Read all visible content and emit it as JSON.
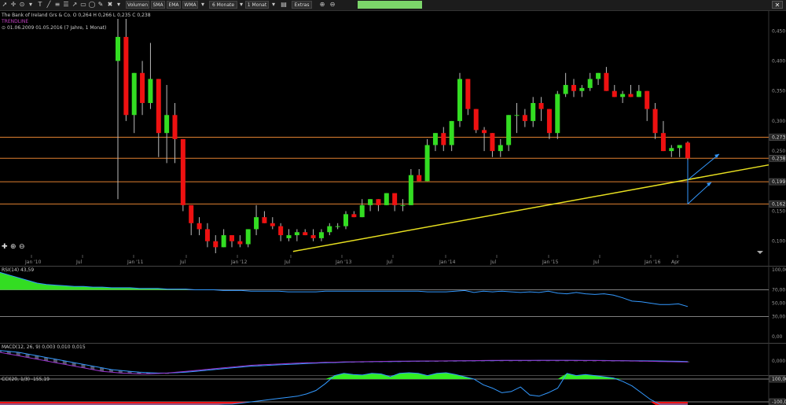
{
  "toolbar": {
    "buttons": [
      "Volumen",
      "SMA",
      "EMA",
      "WMA",
      "6 Monate",
      "1 Monat",
      "Extras"
    ],
    "close_label": "✕"
  },
  "info": {
    "symbol": "The Bank of Ireland Grs & Co.",
    "ohlc": "O 0,264  H 0,266  L 0,235  C 0,238",
    "overlay": "TRENDLINE",
    "range": "01.06.2009  01.05.2016 (7 Jahre, 1 Monat)"
  },
  "colors": {
    "up": "#33dd22",
    "down": "#ee1111",
    "hline": "#e08030",
    "trend": "#e8e020",
    "arrow": "#3399ff",
    "indicator_line": "#3399ff",
    "rsi_fill": "#33dd22",
    "macd_line": "#9933cc",
    "cci_up": "#33ee22",
    "cci_down": "#ee1111"
  },
  "chart_data": [
    {
      "type": "candlestick",
      "title": "The Bank of Ireland Grs & Co.",
      "x_ticks": [
        "Jan '10",
        "Jul",
        "Jan '11",
        "Jul",
        "Jan '12",
        "Jul",
        "Jan '13",
        "Jul",
        "Jan '14",
        "Jul",
        "Jan '15",
        "Jul",
        "Jan '16",
        "Apr"
      ],
      "y_ticks": [
        "0,450",
        "0,400",
        "0,350",
        "0,300",
        "0,250",
        "0,200",
        "0,150",
        "0,100"
      ],
      "ylim": [
        0.08,
        0.47
      ],
      "horizontal_levels": [
        "0,273",
        "0,238",
        "0,199",
        "0,162"
      ],
      "candles": [
        {
          "o": 0.4,
          "h": 0.47,
          "l": 0.17,
          "c": 0.44
        },
        {
          "o": 0.44,
          "h": 0.47,
          "l": 0.3,
          "c": 0.31
        },
        {
          "o": 0.31,
          "h": 0.38,
          "l": 0.28,
          "c": 0.38
        },
        {
          "o": 0.38,
          "h": 0.4,
          "l": 0.31,
          "c": 0.33
        },
        {
          "o": 0.33,
          "h": 0.43,
          "l": 0.32,
          "c": 0.37
        },
        {
          "o": 0.37,
          "h": 0.37,
          "l": 0.24,
          "c": 0.28
        },
        {
          "o": 0.28,
          "h": 0.36,
          "l": 0.23,
          "c": 0.31
        },
        {
          "o": 0.31,
          "h": 0.33,
          "l": 0.23,
          "c": 0.27
        },
        {
          "o": 0.27,
          "h": 0.27,
          "l": 0.15,
          "c": 0.16
        },
        {
          "o": 0.16,
          "h": 0.16,
          "l": 0.11,
          "c": 0.13
        },
        {
          "o": 0.13,
          "h": 0.14,
          "l": 0.11,
          "c": 0.12
        },
        {
          "o": 0.12,
          "h": 0.13,
          "l": 0.09,
          "c": 0.1
        },
        {
          "o": 0.1,
          "h": 0.11,
          "l": 0.08,
          "c": 0.09
        },
        {
          "o": 0.09,
          "h": 0.12,
          "l": 0.09,
          "c": 0.11
        },
        {
          "o": 0.11,
          "h": 0.11,
          "l": 0.09,
          "c": 0.1
        },
        {
          "o": 0.1,
          "h": 0.11,
          "l": 0.09,
          "c": 0.095
        },
        {
          "o": 0.095,
          "h": 0.12,
          "l": 0.09,
          "c": 0.12
        },
        {
          "o": 0.12,
          "h": 0.16,
          "l": 0.11,
          "c": 0.14
        },
        {
          "o": 0.14,
          "h": 0.15,
          "l": 0.13,
          "c": 0.13
        },
        {
          "o": 0.13,
          "h": 0.14,
          "l": 0.12,
          "c": 0.125
        },
        {
          "o": 0.125,
          "h": 0.13,
          "l": 0.1,
          "c": 0.11
        },
        {
          "o": 0.105,
          "h": 0.12,
          "l": 0.1,
          "c": 0.11
        },
        {
          "o": 0.11,
          "h": 0.12,
          "l": 0.1,
          "c": 0.115
        },
        {
          "o": 0.115,
          "h": 0.12,
          "l": 0.11,
          "c": 0.11
        },
        {
          "o": 0.11,
          "h": 0.12,
          "l": 0.1,
          "c": 0.105
        },
        {
          "o": 0.105,
          "h": 0.12,
          "l": 0.1,
          "c": 0.115
        },
        {
          "o": 0.115,
          "h": 0.13,
          "l": 0.11,
          "c": 0.125
        },
        {
          "o": 0.125,
          "h": 0.13,
          "l": 0.12,
          "c": 0.125
        },
        {
          "o": 0.125,
          "h": 0.15,
          "l": 0.12,
          "c": 0.145
        },
        {
          "o": 0.145,
          "h": 0.15,
          "l": 0.14,
          "c": 0.14
        },
        {
          "o": 0.14,
          "h": 0.17,
          "l": 0.14,
          "c": 0.16
        },
        {
          "o": 0.16,
          "h": 0.17,
          "l": 0.15,
          "c": 0.17
        },
        {
          "o": 0.17,
          "h": 0.17,
          "l": 0.15,
          "c": 0.16
        },
        {
          "o": 0.16,
          "h": 0.18,
          "l": 0.16,
          "c": 0.18
        },
        {
          "o": 0.18,
          "h": 0.17,
          "l": 0.15,
          "c": 0.16
        },
        {
          "o": 0.16,
          "h": 0.17,
          "l": 0.15,
          "c": 0.16
        },
        {
          "o": 0.16,
          "h": 0.22,
          "l": 0.16,
          "c": 0.21
        },
        {
          "o": 0.21,
          "h": 0.22,
          "l": 0.2,
          "c": 0.2
        },
        {
          "o": 0.2,
          "h": 0.27,
          "l": 0.2,
          "c": 0.26
        },
        {
          "o": 0.26,
          "h": 0.28,
          "l": 0.25,
          "c": 0.28
        },
        {
          "o": 0.28,
          "h": 0.29,
          "l": 0.25,
          "c": 0.26
        },
        {
          "o": 0.26,
          "h": 0.3,
          "l": 0.25,
          "c": 0.3
        },
        {
          "o": 0.3,
          "h": 0.38,
          "l": 0.29,
          "c": 0.37
        },
        {
          "o": 0.37,
          "h": 0.37,
          "l": 0.31,
          "c": 0.32
        },
        {
          "o": 0.32,
          "h": 0.32,
          "l": 0.28,
          "c": 0.285
        },
        {
          "o": 0.285,
          "h": 0.29,
          "l": 0.25,
          "c": 0.28
        },
        {
          "o": 0.28,
          "h": 0.28,
          "l": 0.24,
          "c": 0.25
        },
        {
          "o": 0.25,
          "h": 0.27,
          "l": 0.24,
          "c": 0.26
        },
        {
          "o": 0.26,
          "h": 0.31,
          "l": 0.25,
          "c": 0.31
        },
        {
          "o": 0.31,
          "h": 0.33,
          "l": 0.28,
          "c": 0.31
        },
        {
          "o": 0.31,
          "h": 0.32,
          "l": 0.29,
          "c": 0.3
        },
        {
          "o": 0.3,
          "h": 0.34,
          "l": 0.29,
          "c": 0.33
        },
        {
          "o": 0.33,
          "h": 0.34,
          "l": 0.3,
          "c": 0.32
        },
        {
          "o": 0.32,
          "h": 0.32,
          "l": 0.27,
          "c": 0.28
        },
        {
          "o": 0.28,
          "h": 0.35,
          "l": 0.27,
          "c": 0.345
        },
        {
          "o": 0.345,
          "h": 0.38,
          "l": 0.34,
          "c": 0.36
        },
        {
          "o": 0.36,
          "h": 0.37,
          "l": 0.34,
          "c": 0.35
        },
        {
          "o": 0.35,
          "h": 0.36,
          "l": 0.34,
          "c": 0.355
        },
        {
          "o": 0.355,
          "h": 0.38,
          "l": 0.35,
          "c": 0.37
        },
        {
          "o": 0.37,
          "h": 0.38,
          "l": 0.36,
          "c": 0.38
        },
        {
          "o": 0.38,
          "h": 0.39,
          "l": 0.35,
          "c": 0.35
        },
        {
          "o": 0.35,
          "h": 0.36,
          "l": 0.34,
          "c": 0.34
        },
        {
          "o": 0.34,
          "h": 0.35,
          "l": 0.33,
          "c": 0.345
        },
        {
          "o": 0.345,
          "h": 0.36,
          "l": 0.34,
          "c": 0.34
        },
        {
          "o": 0.34,
          "h": 0.36,
          "l": 0.34,
          "c": 0.35
        },
        {
          "o": 0.35,
          "h": 0.35,
          "l": 0.3,
          "c": 0.32
        },
        {
          "o": 0.32,
          "h": 0.33,
          "l": 0.27,
          "c": 0.28
        },
        {
          "o": 0.28,
          "h": 0.3,
          "l": 0.25,
          "c": 0.25
        },
        {
          "o": 0.25,
          "h": 0.26,
          "l": 0.24,
          "c": 0.255
        },
        {
          "o": 0.255,
          "h": 0.26,
          "l": 0.24,
          "c": 0.26
        },
        {
          "o": 0.264,
          "h": 0.266,
          "l": 0.235,
          "c": 0.238
        }
      ]
    },
    {
      "type": "line",
      "title": "RSI(14)  43,59",
      "y_ticks": [
        "100,00",
        "70,00",
        "50,00",
        "30,00",
        "0,00"
      ],
      "ylim": [
        0,
        100
      ],
      "levels": [
        70,
        30
      ],
      "values": [
        96,
        92,
        88,
        84,
        80,
        78,
        77,
        76,
        75,
        75,
        74,
        74,
        73,
        73,
        73,
        72,
        72,
        72,
        71,
        71,
        71,
        70,
        70,
        70,
        69,
        69,
        69,
        68,
        68,
        68,
        68,
        67,
        67,
        67,
        67,
        68,
        68,
        68,
        68,
        68,
        68,
        68,
        68,
        68,
        68,
        68,
        67,
        67,
        67,
        68,
        69,
        66,
        68,
        67,
        68,
        67,
        66,
        67,
        66,
        68,
        65,
        64,
        66,
        64,
        63,
        64,
        62,
        58,
        53,
        52,
        50,
        48,
        48,
        49,
        45
      ]
    },
    {
      "type": "line",
      "title": "MACD(12, 26, 9)  0,003  0,010  0,015",
      "y_ticks": [
        "0,000"
      ],
      "series": [
        {
          "values": [
            0.1,
            0.08,
            0.06,
            0.04,
            0.02,
            0.0,
            -0.02,
            -0.04,
            -0.06,
            -0.08,
            -0.1,
            -0.12,
            -0.13,
            -0.14,
            -0.145,
            -0.15,
            -0.15,
            -0.145,
            -0.14,
            -0.13,
            -0.12,
            -0.11,
            -0.1,
            -0.09,
            -0.08,
            -0.07,
            -0.06,
            -0.05,
            -0.045,
            -0.04,
            -0.035,
            -0.03,
            -0.025,
            -0.02,
            -0.02,
            -0.015,
            -0.015,
            -0.01,
            -0.01,
            -0.008,
            -0.006,
            -0.005,
            -0.004,
            -0.003,
            -0.002,
            -0.001,
            0.0,
            0.0,
            0.001,
            0.002,
            0.003,
            0.004,
            0.005,
            0.006,
            0.006,
            0.006,
            0.006,
            0.006,
            0.007,
            0.007,
            0.006,
            0.006,
            0.005,
            0.005,
            0.005,
            0.004,
            0.003,
            0.002,
            0.0,
            -0.002,
            -0.004,
            -0.006,
            -0.008,
            -0.01,
            -0.012
          ]
        },
        {
          "values": [
            0.12,
            0.11,
            0.1,
            0.08,
            0.06,
            0.04,
            0.02,
            0.0,
            -0.02,
            -0.04,
            -0.06,
            -0.08,
            -0.1,
            -0.11,
            -0.12,
            -0.13,
            -0.135,
            -0.14,
            -0.14,
            -0.135,
            -0.13,
            -0.12,
            -0.11,
            -0.1,
            -0.09,
            -0.08,
            -0.07,
            -0.06,
            -0.055,
            -0.05,
            -0.045,
            -0.04,
            -0.035,
            -0.03,
            -0.025,
            -0.02,
            -0.018,
            -0.015,
            -0.012,
            -0.01,
            -0.008,
            -0.007,
            -0.006,
            -0.005,
            -0.004,
            -0.003,
            -0.002,
            -0.001,
            0.0,
            0.001,
            0.002,
            0.003,
            0.004,
            0.004,
            0.005,
            0.005,
            0.005,
            0.005,
            0.006,
            0.006,
            0.006,
            0.006,
            0.006,
            0.005,
            0.005,
            0.005,
            0.004,
            0.004,
            0.003,
            0.002,
            0.001,
            0.0,
            -0.002,
            -0.004,
            -0.006
          ]
        }
      ]
    },
    {
      "type": "area",
      "title": "CCI(20, 1/3)  -155,19",
      "y_ticks": [
        "100,00",
        "-100,00"
      ],
      "levels": [
        100,
        -100
      ],
      "values": [
        -180,
        -170,
        -160,
        -150,
        -150,
        -155,
        -160,
        -165,
        -170,
        -170,
        -175,
        -180,
        -180,
        -178,
        -175,
        -170,
        -170,
        -168,
        -165,
        -160,
        -150,
        -145,
        -140,
        -130,
        -125,
        -120,
        -110,
        -100,
        -90,
        -80,
        -70,
        -60,
        -50,
        -30,
        0,
        60,
        130,
        150,
        140,
        135,
        150,
        145,
        120,
        150,
        155,
        150,
        130,
        150,
        155,
        140,
        120,
        100,
        50,
        20,
        -20,
        -10,
        30,
        -40,
        -50,
        -20,
        20,
        150,
        130,
        140,
        130,
        120,
        110,
        80,
        40,
        -20,
        -80,
        -150,
        -200,
        -220,
        -200
      ]
    }
  ]
}
